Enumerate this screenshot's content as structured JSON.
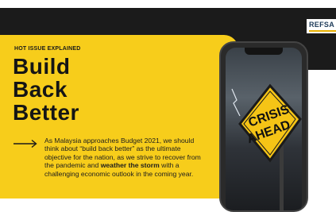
{
  "brand": {
    "logo_text": "REFSA"
  },
  "card": {
    "kicker": "HOT ISSUE EXPLAINED",
    "headline": [
      "Build",
      "Back",
      "Better"
    ],
    "summary_part1": "As Malaysia approaches Budget 2021, we should think about “build back better” as the ultimate objective for the nation, as we strive to recover from the pandemic and ",
    "summary_bold": "weather the storm",
    "summary_part2": " with a challenging economic outlook in the coming year."
  },
  "phone": {
    "sign_line1": "CRISIS",
    "sign_line2": "AHEAD"
  },
  "colors": {
    "accent_yellow": "#f7cd1b",
    "dark_band": "#1b1b1b"
  },
  "icons": {
    "arrow": "right-arrow-icon"
  }
}
